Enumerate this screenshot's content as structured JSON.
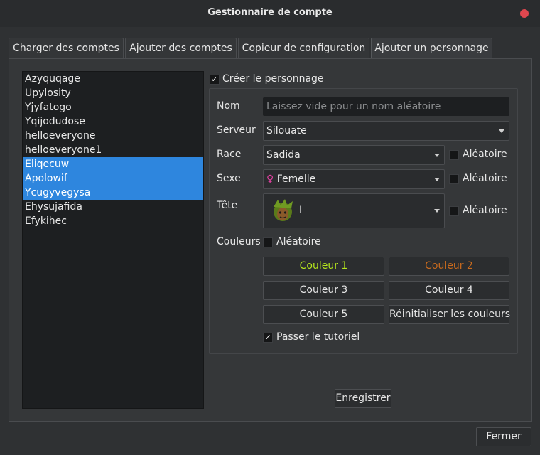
{
  "window": {
    "title": "Gestionnaire de compte"
  },
  "tabs": [
    {
      "label": "Charger des comptes"
    },
    {
      "label": "Ajouter des comptes"
    },
    {
      "label": "Copieur de configuration"
    },
    {
      "label": "Ajouter un personnage"
    }
  ],
  "accounts": [
    {
      "name": "Azyquqage",
      "selected": false
    },
    {
      "name": "Upylosity",
      "selected": false
    },
    {
      "name": "Yjyfatogo",
      "selected": false
    },
    {
      "name": "Yqijodudose",
      "selected": false
    },
    {
      "name": "helloeveryone",
      "selected": false
    },
    {
      "name": "helloeveryone1",
      "selected": false
    },
    {
      "name": "Eliqecuw",
      "selected": true
    },
    {
      "name": "Apolowif",
      "selected": true
    },
    {
      "name": "Ycugyvegysa",
      "selected": true
    },
    {
      "name": "Ehysujafida",
      "selected": false
    },
    {
      "name": "Efykihec",
      "selected": false
    }
  ],
  "form": {
    "create_label": "Créer le personnage",
    "create_checked": true,
    "name_label": "Nom",
    "name_placeholder": "Laissez vide pour un nom aléatoire",
    "server_label": "Serveur",
    "server_value": "Silouate",
    "race_label": "Race",
    "race_value": "Sadida",
    "sex_label": "Sexe",
    "sex_symbol": "♀",
    "sex_value": "Femelle",
    "head_label": "Tête",
    "head_value": "I",
    "random_label": "Aléatoire",
    "colors_label": "Couleurs",
    "colors_random_label": "Aléatoire",
    "color_buttons": [
      "Couleur 1",
      "Couleur 2",
      "Couleur 3",
      "Couleur 4",
      "Couleur 5"
    ],
    "color_button_colors": [
      "#b5e61d",
      "#c86a1e",
      "#e6e6e6",
      "#e6e6e6",
      "#e6e6e6"
    ],
    "reset_colors_label": "Réinitialiser les couleurs",
    "skip_tutorial_label": "Passer le tutoriel",
    "skip_tutorial_checked": true
  },
  "save_label": "Enregistrer",
  "close_label": "Fermer"
}
